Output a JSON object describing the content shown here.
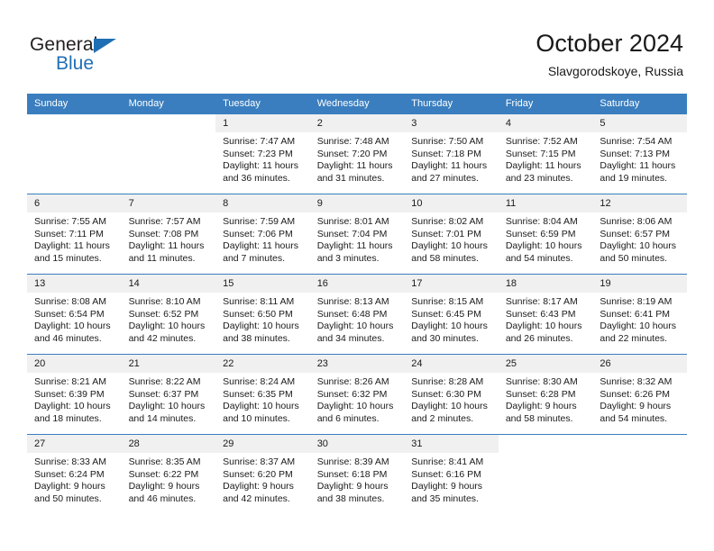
{
  "brand": {
    "name_part1": "General",
    "name_part2": "Blue",
    "triangle_color": "#1f6fb5"
  },
  "header": {
    "title": "October 2024",
    "subtitle": "Slavgorodskoye, Russia"
  },
  "theme": {
    "header_bg": "#3a7ebf",
    "daynum_bg": "#f0f0f0",
    "text": "#1a1a1a",
    "accent": "#1f6fb5"
  },
  "weekdays": [
    "Sunday",
    "Monday",
    "Tuesday",
    "Wednesday",
    "Thursday",
    "Friday",
    "Saturday"
  ],
  "weeks": [
    [
      {
        "day": "",
        "sunrise": "",
        "sunset": "",
        "daylight1": "",
        "daylight2": ""
      },
      {
        "day": "",
        "sunrise": "",
        "sunset": "",
        "daylight1": "",
        "daylight2": ""
      },
      {
        "day": "1",
        "sunrise": "Sunrise: 7:47 AM",
        "sunset": "Sunset: 7:23 PM",
        "daylight1": "Daylight: 11 hours",
        "daylight2": "and 36 minutes."
      },
      {
        "day": "2",
        "sunrise": "Sunrise: 7:48 AM",
        "sunset": "Sunset: 7:20 PM",
        "daylight1": "Daylight: 11 hours",
        "daylight2": "and 31 minutes."
      },
      {
        "day": "3",
        "sunrise": "Sunrise: 7:50 AM",
        "sunset": "Sunset: 7:18 PM",
        "daylight1": "Daylight: 11 hours",
        "daylight2": "and 27 minutes."
      },
      {
        "day": "4",
        "sunrise": "Sunrise: 7:52 AM",
        "sunset": "Sunset: 7:15 PM",
        "daylight1": "Daylight: 11 hours",
        "daylight2": "and 23 minutes."
      },
      {
        "day": "5",
        "sunrise": "Sunrise: 7:54 AM",
        "sunset": "Sunset: 7:13 PM",
        "daylight1": "Daylight: 11 hours",
        "daylight2": "and 19 minutes."
      }
    ],
    [
      {
        "day": "6",
        "sunrise": "Sunrise: 7:55 AM",
        "sunset": "Sunset: 7:11 PM",
        "daylight1": "Daylight: 11 hours",
        "daylight2": "and 15 minutes."
      },
      {
        "day": "7",
        "sunrise": "Sunrise: 7:57 AM",
        "sunset": "Sunset: 7:08 PM",
        "daylight1": "Daylight: 11 hours",
        "daylight2": "and 11 minutes."
      },
      {
        "day": "8",
        "sunrise": "Sunrise: 7:59 AM",
        "sunset": "Sunset: 7:06 PM",
        "daylight1": "Daylight: 11 hours",
        "daylight2": "and 7 minutes."
      },
      {
        "day": "9",
        "sunrise": "Sunrise: 8:01 AM",
        "sunset": "Sunset: 7:04 PM",
        "daylight1": "Daylight: 11 hours",
        "daylight2": "and 3 minutes."
      },
      {
        "day": "10",
        "sunrise": "Sunrise: 8:02 AM",
        "sunset": "Sunset: 7:01 PM",
        "daylight1": "Daylight: 10 hours",
        "daylight2": "and 58 minutes."
      },
      {
        "day": "11",
        "sunrise": "Sunrise: 8:04 AM",
        "sunset": "Sunset: 6:59 PM",
        "daylight1": "Daylight: 10 hours",
        "daylight2": "and 54 minutes."
      },
      {
        "day": "12",
        "sunrise": "Sunrise: 8:06 AM",
        "sunset": "Sunset: 6:57 PM",
        "daylight1": "Daylight: 10 hours",
        "daylight2": "and 50 minutes."
      }
    ],
    [
      {
        "day": "13",
        "sunrise": "Sunrise: 8:08 AM",
        "sunset": "Sunset: 6:54 PM",
        "daylight1": "Daylight: 10 hours",
        "daylight2": "and 46 minutes."
      },
      {
        "day": "14",
        "sunrise": "Sunrise: 8:10 AM",
        "sunset": "Sunset: 6:52 PM",
        "daylight1": "Daylight: 10 hours",
        "daylight2": "and 42 minutes."
      },
      {
        "day": "15",
        "sunrise": "Sunrise: 8:11 AM",
        "sunset": "Sunset: 6:50 PM",
        "daylight1": "Daylight: 10 hours",
        "daylight2": "and 38 minutes."
      },
      {
        "day": "16",
        "sunrise": "Sunrise: 8:13 AM",
        "sunset": "Sunset: 6:48 PM",
        "daylight1": "Daylight: 10 hours",
        "daylight2": "and 34 minutes."
      },
      {
        "day": "17",
        "sunrise": "Sunrise: 8:15 AM",
        "sunset": "Sunset: 6:45 PM",
        "daylight1": "Daylight: 10 hours",
        "daylight2": "and 30 minutes."
      },
      {
        "day": "18",
        "sunrise": "Sunrise: 8:17 AM",
        "sunset": "Sunset: 6:43 PM",
        "daylight1": "Daylight: 10 hours",
        "daylight2": "and 26 minutes."
      },
      {
        "day": "19",
        "sunrise": "Sunrise: 8:19 AM",
        "sunset": "Sunset: 6:41 PM",
        "daylight1": "Daylight: 10 hours",
        "daylight2": "and 22 minutes."
      }
    ],
    [
      {
        "day": "20",
        "sunrise": "Sunrise: 8:21 AM",
        "sunset": "Sunset: 6:39 PM",
        "daylight1": "Daylight: 10 hours",
        "daylight2": "and 18 minutes."
      },
      {
        "day": "21",
        "sunrise": "Sunrise: 8:22 AM",
        "sunset": "Sunset: 6:37 PM",
        "daylight1": "Daylight: 10 hours",
        "daylight2": "and 14 minutes."
      },
      {
        "day": "22",
        "sunrise": "Sunrise: 8:24 AM",
        "sunset": "Sunset: 6:35 PM",
        "daylight1": "Daylight: 10 hours",
        "daylight2": "and 10 minutes."
      },
      {
        "day": "23",
        "sunrise": "Sunrise: 8:26 AM",
        "sunset": "Sunset: 6:32 PM",
        "daylight1": "Daylight: 10 hours",
        "daylight2": "and 6 minutes."
      },
      {
        "day": "24",
        "sunrise": "Sunrise: 8:28 AM",
        "sunset": "Sunset: 6:30 PM",
        "daylight1": "Daylight: 10 hours",
        "daylight2": "and 2 minutes."
      },
      {
        "day": "25",
        "sunrise": "Sunrise: 8:30 AM",
        "sunset": "Sunset: 6:28 PM",
        "daylight1": "Daylight: 9 hours",
        "daylight2": "and 58 minutes."
      },
      {
        "day": "26",
        "sunrise": "Sunrise: 8:32 AM",
        "sunset": "Sunset: 6:26 PM",
        "daylight1": "Daylight: 9 hours",
        "daylight2": "and 54 minutes."
      }
    ],
    [
      {
        "day": "27",
        "sunrise": "Sunrise: 8:33 AM",
        "sunset": "Sunset: 6:24 PM",
        "daylight1": "Daylight: 9 hours",
        "daylight2": "and 50 minutes."
      },
      {
        "day": "28",
        "sunrise": "Sunrise: 8:35 AM",
        "sunset": "Sunset: 6:22 PM",
        "daylight1": "Daylight: 9 hours",
        "daylight2": "and 46 minutes."
      },
      {
        "day": "29",
        "sunrise": "Sunrise: 8:37 AM",
        "sunset": "Sunset: 6:20 PM",
        "daylight1": "Daylight: 9 hours",
        "daylight2": "and 42 minutes."
      },
      {
        "day": "30",
        "sunrise": "Sunrise: 8:39 AM",
        "sunset": "Sunset: 6:18 PM",
        "daylight1": "Daylight: 9 hours",
        "daylight2": "and 38 minutes."
      },
      {
        "day": "31",
        "sunrise": "Sunrise: 8:41 AM",
        "sunset": "Sunset: 6:16 PM",
        "daylight1": "Daylight: 9 hours",
        "daylight2": "and 35 minutes."
      },
      {
        "day": "",
        "sunrise": "",
        "sunset": "",
        "daylight1": "",
        "daylight2": ""
      },
      {
        "day": "",
        "sunrise": "",
        "sunset": "",
        "daylight1": "",
        "daylight2": ""
      }
    ]
  ]
}
